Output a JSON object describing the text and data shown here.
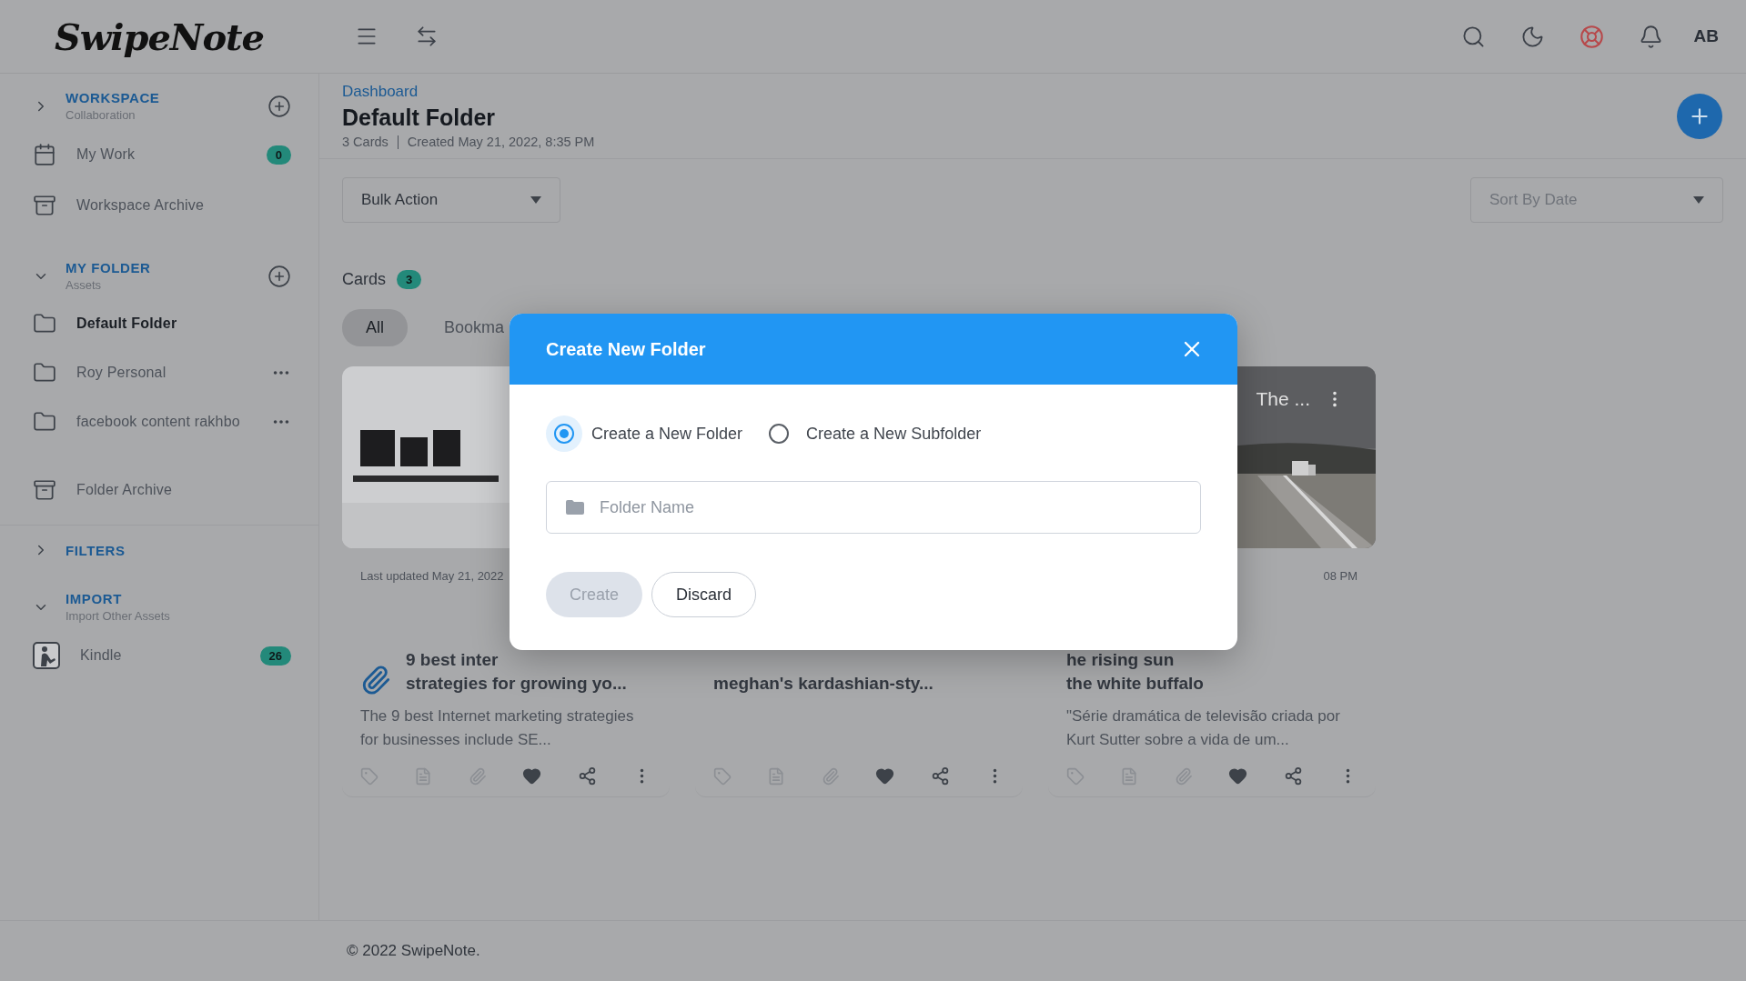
{
  "header": {
    "logo": "SwipeNote",
    "avatar": "AB"
  },
  "sidebar": {
    "sections": [
      {
        "title": "WORKSPACE",
        "subtitle": "Collaboration",
        "expanded": false,
        "addable": true,
        "items": [
          {
            "kind": "work",
            "label": "My Work",
            "badge": "0",
            "selected": false,
            "menu": false
          },
          {
            "kind": "archive",
            "label": "Workspace Archive",
            "selected": false,
            "menu": false
          }
        ]
      },
      {
        "title": "MY FOLDER",
        "subtitle": "Assets",
        "expanded": true,
        "addable": true,
        "items": [
          {
            "kind": "folder",
            "label": "Default Folder",
            "selected": true,
            "menu": false
          },
          {
            "kind": "folder",
            "label": "Roy Personal",
            "selected": false,
            "menu": true
          },
          {
            "kind": "folder",
            "label": "facebook content rakhbo",
            "selected": false,
            "menu": true
          }
        ]
      },
      {
        "items": [
          {
            "kind": "archive",
            "label": "Folder Archive",
            "selected": false,
            "menu": false
          }
        ]
      },
      {
        "title": "FILTERS",
        "expanded": false,
        "addable": false
      },
      {
        "title": "IMPORT",
        "subtitle": "Import Other Assets",
        "expanded": true,
        "addable": false,
        "items": [
          {
            "kind": "kindle",
            "label": "Kindle",
            "badge": "26",
            "selected": false,
            "menu": false
          }
        ]
      }
    ]
  },
  "page": {
    "breadcrumb": "Dashboard",
    "title": "Default Folder",
    "card_count": "3 Cards",
    "created": "Created May 21, 2022, 8:35 PM"
  },
  "toolbar": {
    "bulk_action": "Bulk Action",
    "sort": "Sort By Date"
  },
  "cards_heading": {
    "label": "Cards",
    "count": "3"
  },
  "filter_tabs": [
    {
      "label": "All",
      "selected": true
    },
    {
      "label": "Bookma",
      "selected": false
    }
  ],
  "cards": [
    {
      "kind": "clip",
      "picture": {
        "kind": "picture"
      },
      "date": "Last updated May 21, 2022",
      "title_lines": [
        "9 best inter",
        "strategies for growing yo..."
      ],
      "description": "The 9 best Internet marketing strategies for businesses include SE..."
    },
    {
      "kind": "plain",
      "title_lines": [
        "meghan's kardashian-sty..."
      ]
    },
    {
      "kind": "plain",
      "picture": {
        "kind": "picture",
        "overlay_title": "The ..."
      },
      "date": "08 PM",
      "title_lines": [
        "he rising sun",
        "the white buffalo"
      ],
      "description": "\"Série dramática de televisão criada por Kurt Sutter sobre a vida de um..."
    }
  ],
  "modal": {
    "title": "Create New Folder",
    "options": [
      {
        "label": "Create a New Folder",
        "selected": true
      },
      {
        "label": "Create a New Subfolder",
        "selected": false
      }
    ],
    "input": {
      "placeholder": "Folder Name"
    },
    "buttons": [
      {
        "label": "Create",
        "kind": "primary",
        "disabled": true
      },
      {
        "label": "Discard",
        "kind": "secondary",
        "disabled": false
      }
    ]
  },
  "footer": "© 2022 SwipeNote."
}
